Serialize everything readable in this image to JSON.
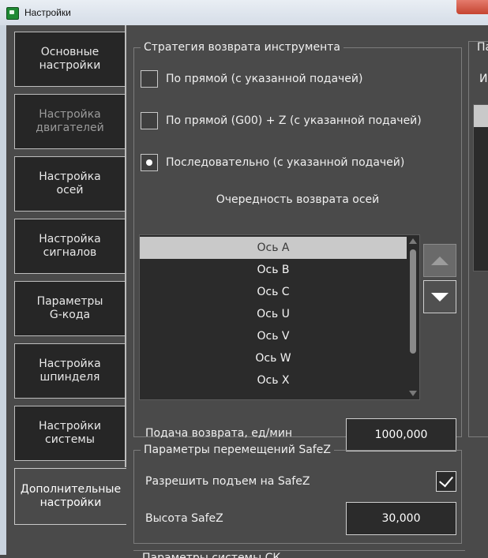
{
  "window": {
    "title": "Настройки"
  },
  "tabs": [
    {
      "label": "Основные\nнастройки",
      "state": "normal"
    },
    {
      "label": "Настройка\nдвигателей",
      "state": "dim"
    },
    {
      "label": "Настройка\nосей",
      "state": "normal"
    },
    {
      "label": "Настройка\nсигналов",
      "state": "normal"
    },
    {
      "label": "Параметры\nG-кода",
      "state": "normal"
    },
    {
      "label": "Настройка\nшпинделя",
      "state": "normal"
    },
    {
      "label": "Настройки\nсистемы",
      "state": "normal"
    },
    {
      "label": "Дополнительные\nнастройки",
      "state": "active"
    }
  ],
  "return_strategy": {
    "title": "Стратегия возврата инструмента",
    "options": [
      {
        "label": "По прямой (с указанной подачей)",
        "checked": false
      },
      {
        "label": "По прямой (G00) + Z (с указанной подачей)",
        "checked": false
      },
      {
        "label": "Последовательно (с указанной подачей)",
        "checked": true
      }
    ],
    "order_title": "Очередность возврата осей",
    "axes": [
      "Ось A",
      "Ось B",
      "Ось C",
      "Ось U",
      "Ось V",
      "Ось W",
      "Ось X"
    ],
    "selected_index": 0,
    "feed_label": "Подача возврата, ед/мин",
    "feed_value": "1000,000"
  },
  "safez": {
    "title": "Параметры перемещений SafeZ",
    "allow_label": "Разрешить подъем на SafeZ",
    "allow_checked": true,
    "height_label": "Высота SafeZ",
    "height_value": "30,000"
  },
  "right_panel": {
    "title": "Па",
    "label": "Ис"
  },
  "bottom_group": {
    "title": "Параметры системы СК"
  }
}
